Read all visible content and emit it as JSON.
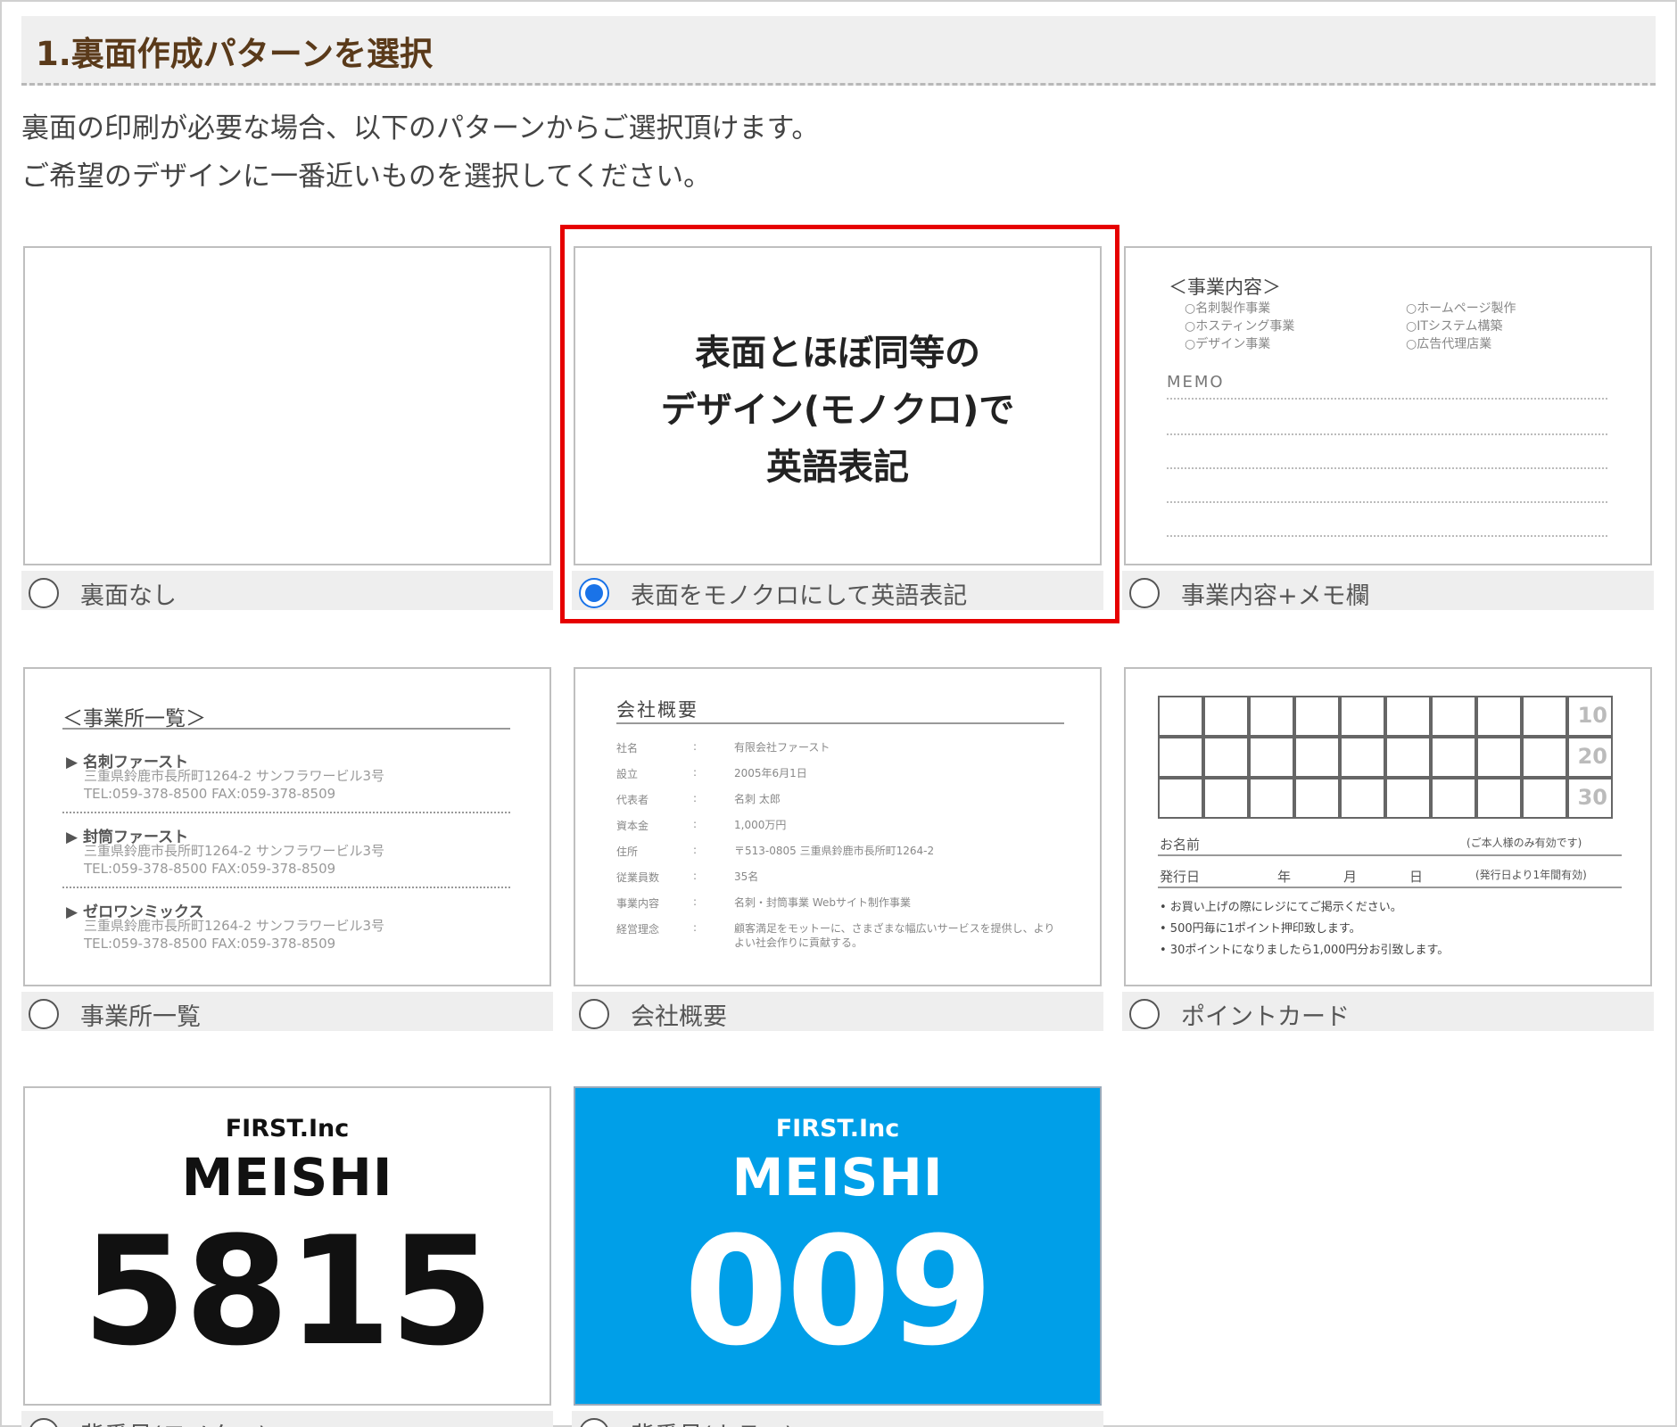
{
  "section": {
    "title": "1.裏面作成パターンを選択",
    "desc1": "裏面の印刷が必要な場合、以下のパターンからご選択頂けます。",
    "desc2": "ご希望のデザインに一番近いものを選択してください。"
  },
  "options": [
    {
      "label": "裏面なし",
      "checked": false
    },
    {
      "label": "表面をモノクロにして英語表記",
      "checked": true
    },
    {
      "label": "事業内容+メモ欄",
      "checked": false
    },
    {
      "label": "事業所一覧",
      "checked": false
    },
    {
      "label": "会社概要",
      "checked": false
    },
    {
      "label": "ポイントカード",
      "checked": false
    },
    {
      "label": "背番号(モノクロ)",
      "checked": false
    },
    {
      "label": "背番号(カラー)",
      "checked": false
    }
  ],
  "card_mono": {
    "line1": "表面とほぼ同等の",
    "line2": "デザイン(モノクロ)で",
    "line3": "英語表記"
  },
  "card_business": {
    "title": "＜事業内容＞",
    "left": [
      "○名刺製作事業",
      "○ホスティング事業",
      "○デザイン事業"
    ],
    "right": [
      "○ホームページ製作",
      "○ITシステム構築",
      "○広告代理店業"
    ],
    "memo": "MEMO"
  },
  "card_offices": {
    "title": "＜事業所一覧＞",
    "entries": [
      {
        "name": "▶ 名刺ファースト",
        "addr": "三重県鈴鹿市長所町1264-2 サンフラワービル3号",
        "tel": "TEL:059-378-8500 FAX:059-378-8509"
      },
      {
        "name": "▶ 封筒ファースト",
        "addr": "三重県鈴鹿市長所町1264-2 サンフラワービル3号",
        "tel": "TEL:059-378-8500 FAX:059-378-8509"
      },
      {
        "name": "▶ ゼロワンミックス",
        "addr": "三重県鈴鹿市長所町1264-2 サンフラワービル3号",
        "tel": "TEL:059-378-8500 FAX:059-378-8509"
      }
    ]
  },
  "card_company": {
    "title": "会社概要",
    "rows": [
      {
        "k": "社名",
        "v": "有限会社ファースト"
      },
      {
        "k": "設立",
        "v": "2005年6月1日"
      },
      {
        "k": "代表者",
        "v": "名刺 太郎"
      },
      {
        "k": "資本金",
        "v": "1,000万円"
      },
      {
        "k": "住所",
        "v": "〒513-0805 三重県鈴鹿市長所町1264-2"
      },
      {
        "k": "従業員数",
        "v": "35名"
      },
      {
        "k": "事業内容",
        "v": "名刺・封筒事業 Webサイト制作事業"
      },
      {
        "k": "経営理念",
        "v": "顧客満足をモットーに、さまざまな幅広いサービスを提供し、よりよい社会作りに貢献する。"
      }
    ]
  },
  "card_point": {
    "nums": [
      "10",
      "20",
      "30"
    ],
    "name_label": "お名前",
    "name_note": "(ご本人様のみ有効です)",
    "issue_label": "発行日",
    "year": "年",
    "month": "月",
    "day": "日",
    "issue_note": "(発行日より1年間有効)",
    "notes": [
      "• お買い上げの際にレジにてご掲示ください。",
      "• 500円毎に1ポイント押印致します。",
      "• 30ポイントになりましたら1,000円分お引致します。"
    ]
  },
  "card_number_mono": {
    "company": "FIRST.Inc",
    "meishi": "MEISHI",
    "number": "5815"
  },
  "card_number_color": {
    "company": "FIRST.Inc",
    "meishi": "MEISHI",
    "number": "009",
    "bg": "#009fe8"
  }
}
